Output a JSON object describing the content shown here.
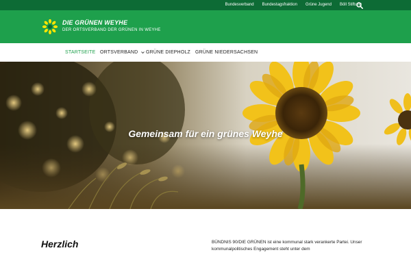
{
  "topbar": {
    "links": [
      "Bundesverband",
      "Bundestagsfraktion",
      "Grüne Jugend",
      "Böll Stiftung"
    ],
    "search_icon": "search-icon"
  },
  "header": {
    "title": "DIE GRÜNEN WEYHE",
    "subtitle": "DER ORTSVERBAND DER GRÜNEN IN WEYHE",
    "logo_icon": "sunflower-icon"
  },
  "nav": {
    "items": [
      {
        "label": "STARTSEITE",
        "active": true
      },
      {
        "label": "ORTSVERBAND",
        "active": false,
        "has_dropdown": true
      },
      {
        "label": "GRÜNE DIEPHOLZ",
        "active": false
      },
      {
        "label": "GRÜNE NIEDERSACHSEN",
        "active": false
      }
    ]
  },
  "hero": {
    "title": "Gemeinsam für ein grünes Weyhe"
  },
  "main": {
    "heading": "Herzlich",
    "intro": "BÜNDNIS 90/DIE GRÜNEN ist eine kommunal stark verankerte Partei. Unser kommunalpolitisches Engagement steht unter dem"
  },
  "colors": {
    "topbar": "#0d6b35",
    "header": "#1ea04c",
    "accent": "#1ea04c"
  }
}
